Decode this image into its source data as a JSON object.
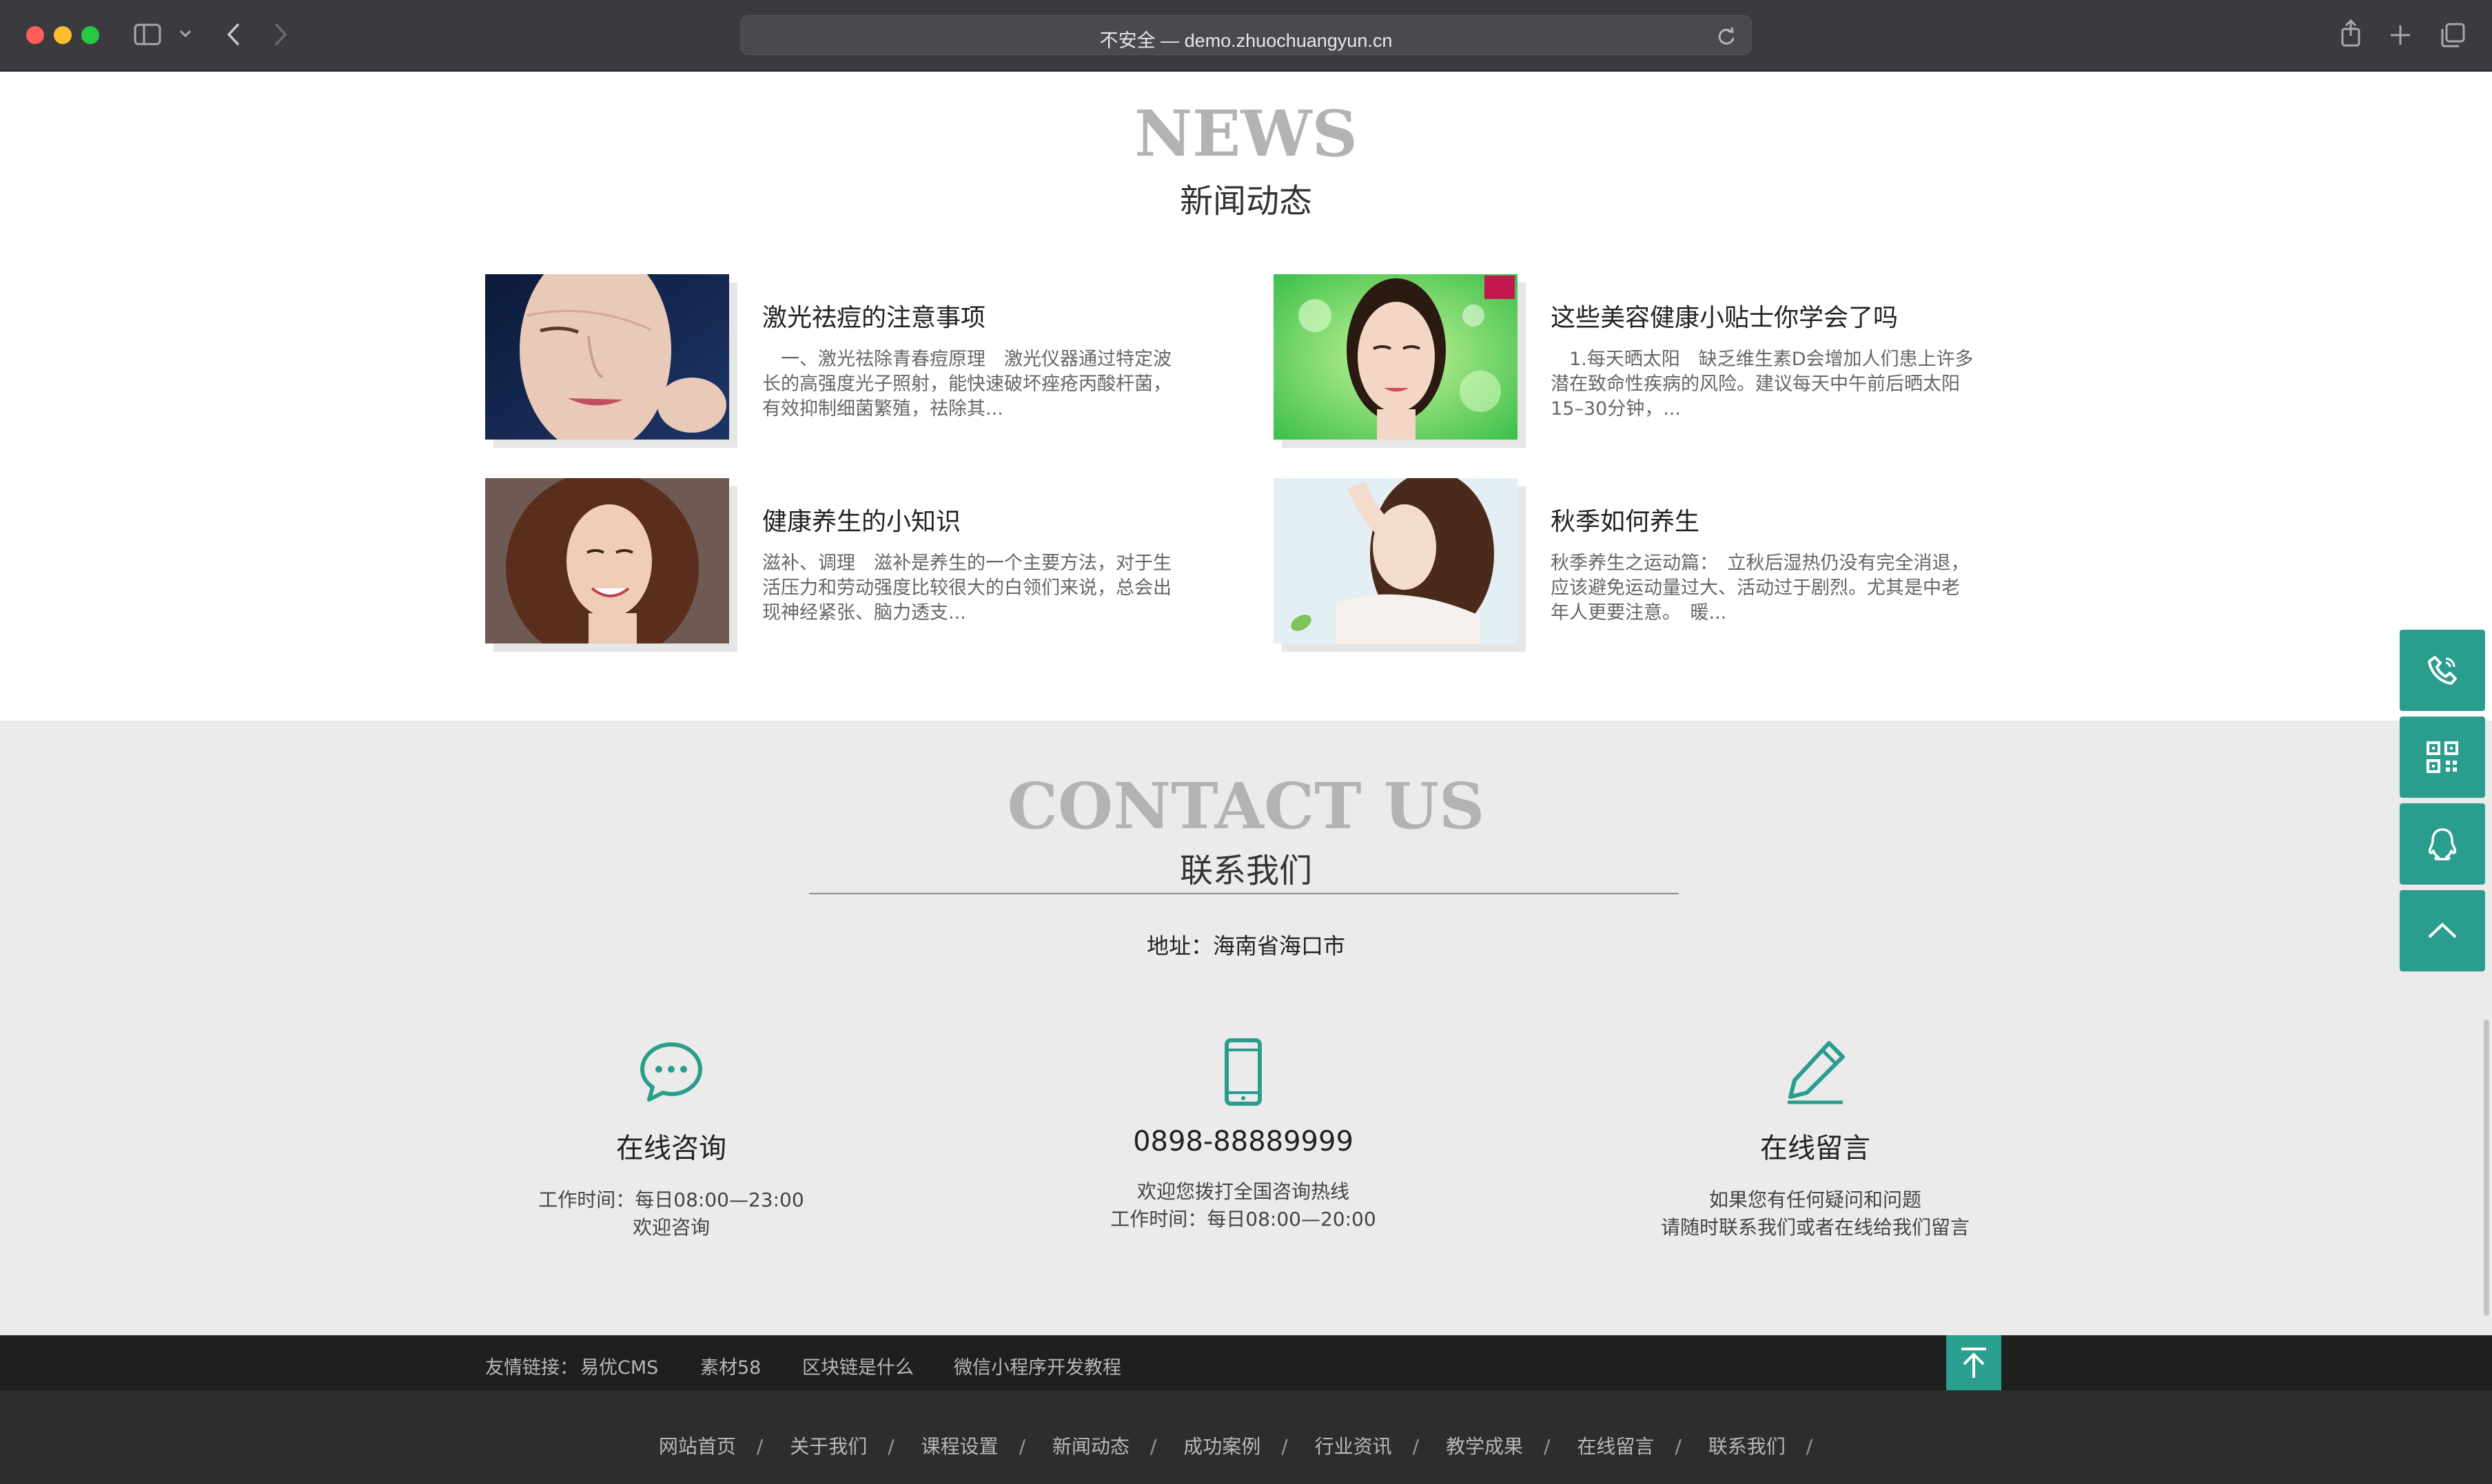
{
  "browser": {
    "url_text": "不安全 — demo.zhuochuangyun.cn"
  },
  "news": {
    "title_en": "NEWS",
    "title_cn": "新闻动态",
    "items": [
      {
        "title": "激光祛痘的注意事项",
        "desc": "　一、激光祛除青春痘原理　激光仪器通过特定波长的高强度光子照射，能快速破坏痤疮丙酸杆菌，有效抑制细菌繁殖，祛除其..."
      },
      {
        "title": "这些美容健康小贴士你学会了吗",
        "desc": "　1.每天晒太阳　缺乏维生素D会增加人们患上许多潜在致命性疾病的风险。建议每天中午前后晒太阳15–30分钟，..."
      },
      {
        "title": "健康养生的小知识",
        "desc": "滋补、调理　滋补是养生的一个主要方法，对于生活压力和劳动强度比较很大的白领们来说，总会出现神经紧张、脑力透支..."
      },
      {
        "title": "秋季如何养生",
        "desc": "秋季养生之运动篇：　立秋后湿热仍没有完全消退，应该避免运动量过大、活动过于剧烈。尤其是中老年人更要注意。　暖..."
      }
    ]
  },
  "contact": {
    "title_en": "CONTACT US",
    "title_cn": "联系我们",
    "address": "地址：海南省海口市",
    "columns": [
      {
        "title": "在线咨询",
        "line1": "工作时间：每日08:00—23:00",
        "line2": "欢迎咨询"
      },
      {
        "title": "0898-88889999",
        "line1": "欢迎您拨打全国咨询热线",
        "line2": "工作时间：每日08:00—20:00"
      },
      {
        "title": "在线留言",
        "line1": "如果您有任何疑问和问题",
        "line2": "请随时联系我们或者在线给我们留言"
      }
    ]
  },
  "footer": {
    "links_label": "友情链接：",
    "links": [
      "易优CMS",
      "素材58",
      "区块链是什么",
      "微信小程序开发教程"
    ],
    "nav": [
      "网站首页",
      "关于我们",
      "课程设置",
      "新闻动态",
      "成功案例",
      "行业资讯",
      "教学成果",
      "在线留言",
      "联系我们"
    ],
    "nav_separator": "/"
  },
  "colors": {
    "accent": "#2a9d8e",
    "footer_bg": "#2d2d2d",
    "contact_bg": "#ebebeb"
  }
}
